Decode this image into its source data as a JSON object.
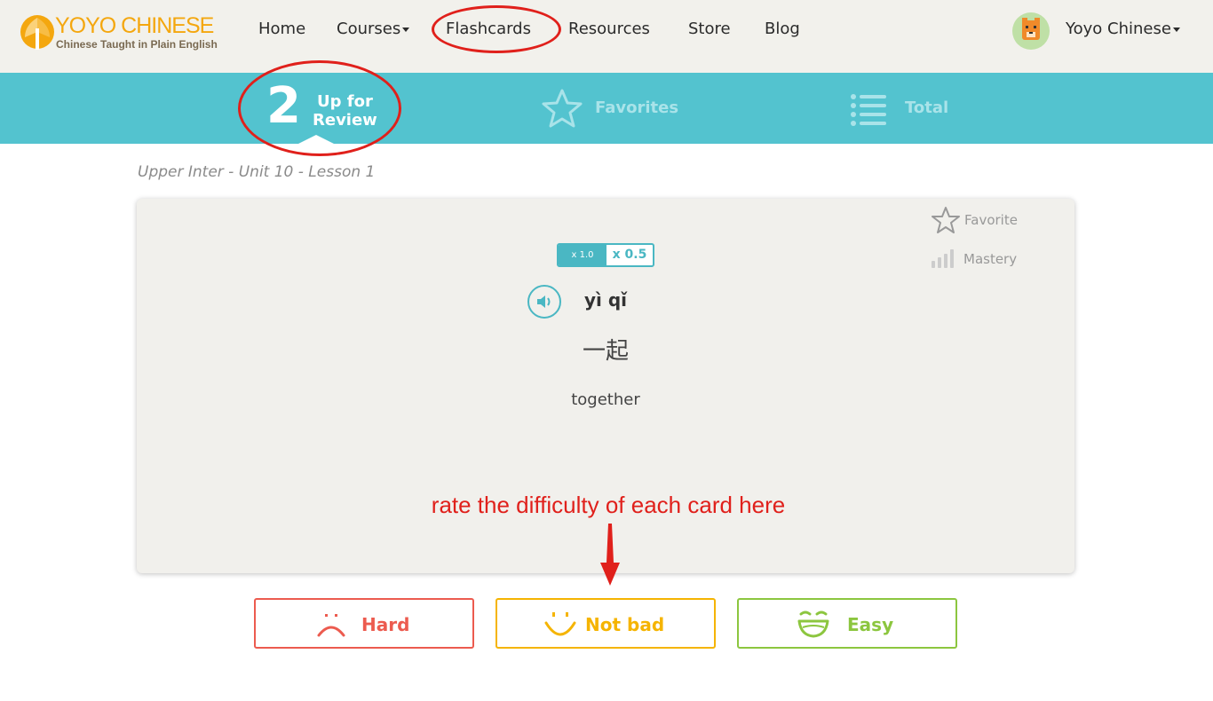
{
  "header": {
    "logo_title": "YOYO CHINESE",
    "logo_subtitle": "Chinese Taught in Plain English",
    "nav": {
      "home": "Home",
      "courses": "Courses",
      "flashcards": "Flashcards",
      "resources": "Resources",
      "store": "Store",
      "blog": "Blog"
    },
    "user_name": "Yoyo Chinese"
  },
  "tabs": {
    "review_count": "2",
    "review_label_line1": "Up for",
    "review_label_line2": "Review",
    "favorites": "Favorites",
    "total": "Total"
  },
  "breadcrumb": "Upper Inter - Unit 10 - Lesson 1",
  "card": {
    "favorite_label": "Favorite",
    "mastery_label": "Mastery",
    "speed_options": [
      "x 1.0",
      "x 0.5"
    ],
    "pinyin": "yì qǐ",
    "hanzi": "一起",
    "english": "together"
  },
  "annotation": {
    "note": "rate the difficulty of each card here"
  },
  "ratings": {
    "hard": "Hard",
    "not_bad": "Not bad",
    "easy": "Easy"
  },
  "colors": {
    "teal": "#53c3cf",
    "hard": "#ec5b4f",
    "not_bad": "#f5b400",
    "easy": "#8cc63f",
    "annotation_red": "#e0201b"
  },
  "icons": {
    "logo": "yoyo-logo-icon",
    "avatar": "tiger-avatar-icon",
    "favorites": "star-icon",
    "total": "list-icon",
    "mastery": "signal-bars-icon",
    "audio": "speaker-icon"
  }
}
